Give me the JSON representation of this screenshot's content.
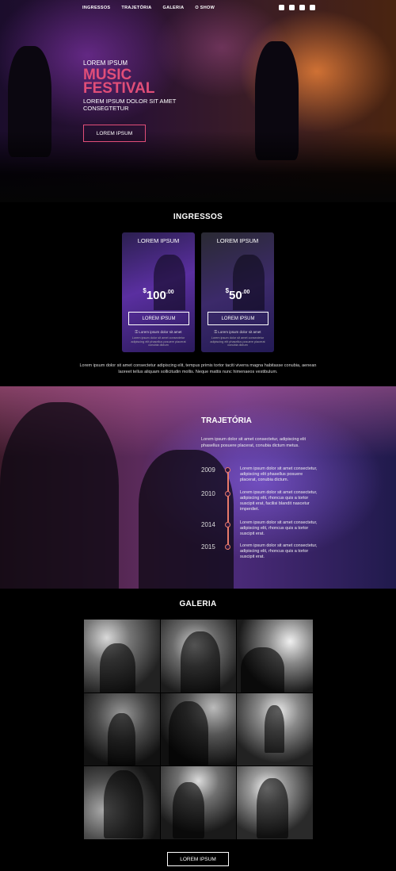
{
  "nav": {
    "items": [
      "INGRESSOS",
      "TRAJETÓRIA",
      "GALERIA",
      "O SHOW"
    ],
    "social_icons": [
      "facebook-icon",
      "twitter-icon",
      "youtube-icon",
      "instagram-icon"
    ]
  },
  "hero": {
    "kicker": "LOREM IPSUM",
    "title_line1": "MUSIC",
    "title_line2": "FESTIVAL",
    "subtitle": "LOREM IPSUM DOLOR SIT AMET CONSEGTETUR",
    "cta": "LOREM IPSUM",
    "accent_color": "#e14e78"
  },
  "ingressos": {
    "title": "INGRESSOS",
    "tickets": [
      {
        "header": "LOREM IPSUM",
        "currency": "$",
        "price": "100",
        "cents": ".00",
        "button": "LOREM IPSUM",
        "note": "Lorem ipsum dolor sit amet",
        "fine_print": "Lorem ipsum dolor sit amet consectetur adipiscing elit phasellus posuere placerat conubia dictum"
      },
      {
        "header": "LOREM IPSUM",
        "currency": "$",
        "price": "50",
        "cents": ".00",
        "button": "LOREM IPSUM",
        "note": "Lorem ipsum dolor sit amet",
        "fine_print": "Lorem ipsum dolor sit amet consectetur adipiscing elit phasellus posuere placerat conubia dictum"
      }
    ],
    "description": "Lorem ipsum dolor sit amet consectetur adipiscing elit, tempus primis tortor taciti viverra magna habitasse conubia, aenean laoreet tellus aliquam sollicitudin mollis. Neque mattis nunc himenaeos vestibulum."
  },
  "trajetoria": {
    "title": "TRAJETÓRIA",
    "lead": "Lorem ipsum dolor sit amet consectetur, adipiscing elit phasellus posuere placerat, conubia dictum metus.",
    "timeline": [
      {
        "year": "2009",
        "text": "Lorem ipsum dolor sit amet consectetur, adipiscing elit phasellus posuere placerat, conubia dictum."
      },
      {
        "year": "2010",
        "text": "Lorem ipsum dolor sit amet consectetur, adipiscing elit, rhoncus quis a tortor suscipit erat, facilisi blandit nascetur imperdiet."
      },
      {
        "year": "2014",
        "text": "Lorem ipsum dolor sit amet consectetur, adipiscing elit, rhoncus quis a tortor suscipit erat."
      },
      {
        "year": "2015",
        "text": "Lorem ipsum dolor sit amet consectetur, adipiscing elit, rhoncus quis a tortor suscipit erat."
      }
    ],
    "line_color": "#e87a6a"
  },
  "galeria": {
    "title": "GALERIA",
    "button": "LOREM IPSUM"
  }
}
